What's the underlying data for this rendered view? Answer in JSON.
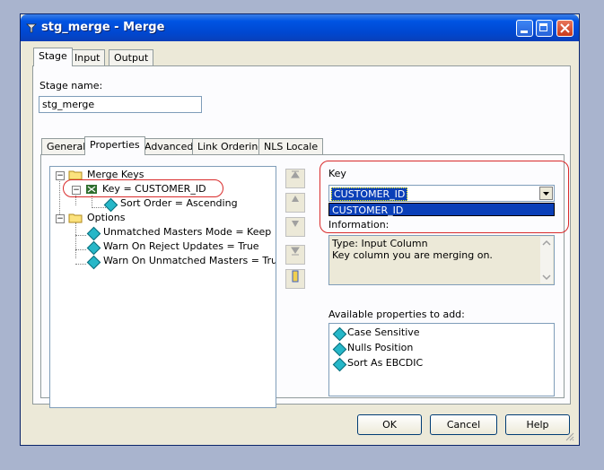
{
  "window": {
    "title": "stg_merge - Merge"
  },
  "top_tabs": [
    "Stage",
    "Input",
    "Output"
  ],
  "stage_name": {
    "label": "Stage name:",
    "value": "stg_merge"
  },
  "inner_tabs": [
    "General",
    "Properties",
    "Advanced",
    "Link Ordering",
    "NLS Locale"
  ],
  "tree": {
    "merge_keys": "Merge Keys",
    "key": "Key = CUSTOMER_ID",
    "sort_order": "Sort Order = Ascending",
    "options": "Options",
    "unmatched_masters_mode": "Unmatched Masters Mode = Keep",
    "warn_reject": "Warn On Reject Updates = True",
    "warn_unmatched": "Warn On Unmatched Masters = True"
  },
  "key_panel": {
    "label": "Key",
    "selected_value": "CUSTOMER_ID",
    "dropdown_option": "CUSTOMER_ID",
    "information_label": "Information:"
  },
  "info_text": {
    "line1": "Type: Input Column",
    "line2": "Key column you are merging on."
  },
  "available": {
    "label": "Available properties to add:",
    "items": [
      "Case Sensitive",
      "Nulls Position",
      "Sort As EBCDIC"
    ]
  },
  "buttons": {
    "ok": "OK",
    "cancel": "Cancel",
    "help": "Help"
  },
  "colors": {
    "title_bar": "#0054e3",
    "selection": "#0a3fb8",
    "highlight_oval": "#d92b2b"
  }
}
